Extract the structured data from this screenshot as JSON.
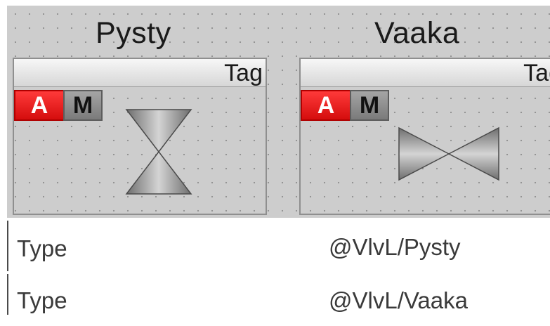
{
  "valves": [
    {
      "title": "Pysty",
      "tag": "Tag",
      "mode_auto": "A",
      "mode_manual": "M",
      "orientation": "vertical"
    },
    {
      "title": "Vaaka",
      "tag": "Tag",
      "mode_auto": "A",
      "mode_manual": "M",
      "orientation": "horizontal"
    }
  ],
  "properties": [
    {
      "label": "Type",
      "value": "@VlvL/Pysty"
    },
    {
      "label": "Type",
      "value": "@VlvL/Vaaka"
    }
  ],
  "colors": {
    "canvas": "#cdcdcd",
    "auto_button": "#e01414",
    "manual_button": "#8a8a8a"
  }
}
